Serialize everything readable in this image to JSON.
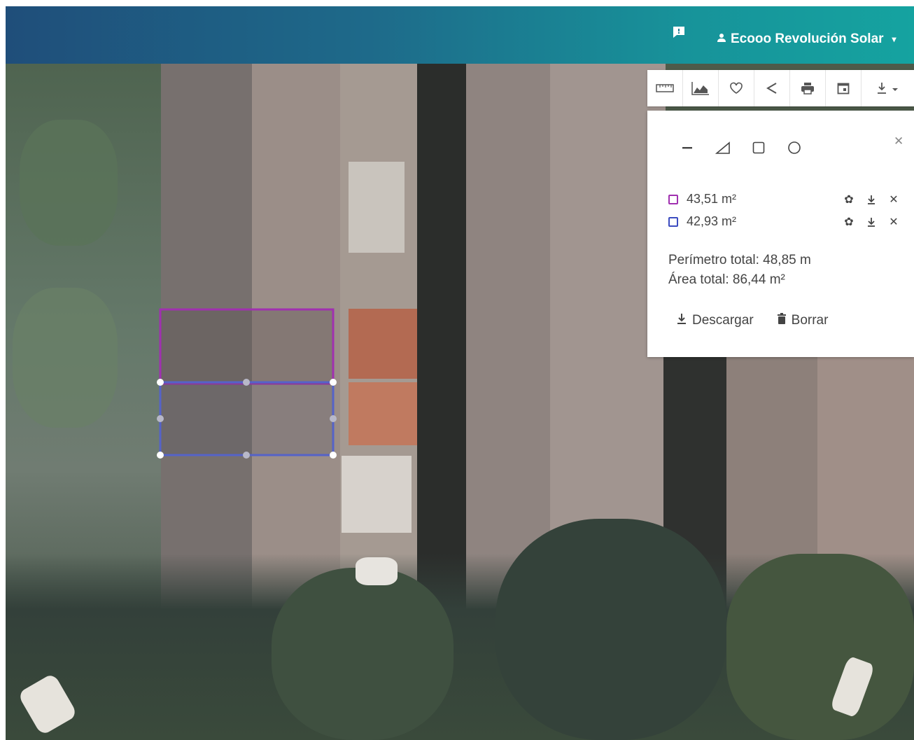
{
  "header": {
    "feedback_icon": "feedback-icon",
    "user_icon": "user-icon",
    "user_name": "Ecooo Revolución Solar",
    "caret_icon": "caret-down-icon",
    "gradient_colors": [
      "#1f4e7a",
      "#17939a",
      "#15a3a0"
    ]
  },
  "toolbar": {
    "tools": [
      "ruler-icon",
      "elevation-profile-icon",
      "heart-icon",
      "share-icon",
      "print-icon",
      "calendar-icon",
      "download-menu-icon"
    ]
  },
  "measure_panel": {
    "shape_tools": [
      "line-icon",
      "polygon-icon",
      "rectangle-icon",
      "circle-icon"
    ],
    "measurements": [
      {
        "value": "43,51 m²",
        "color": "#a030b0"
      },
      {
        "value": "42,93 m²",
        "color": "#3c4cc0"
      }
    ],
    "perimeter_text": "Perímetro total: 48,85 m",
    "area_text": "Área total: 86,44 m²",
    "download_label": "Descargar",
    "delete_label": "Borrar"
  },
  "drawn_shapes": [
    {
      "color": "#a030b0"
    },
    {
      "color": "#5563c8"
    }
  ]
}
